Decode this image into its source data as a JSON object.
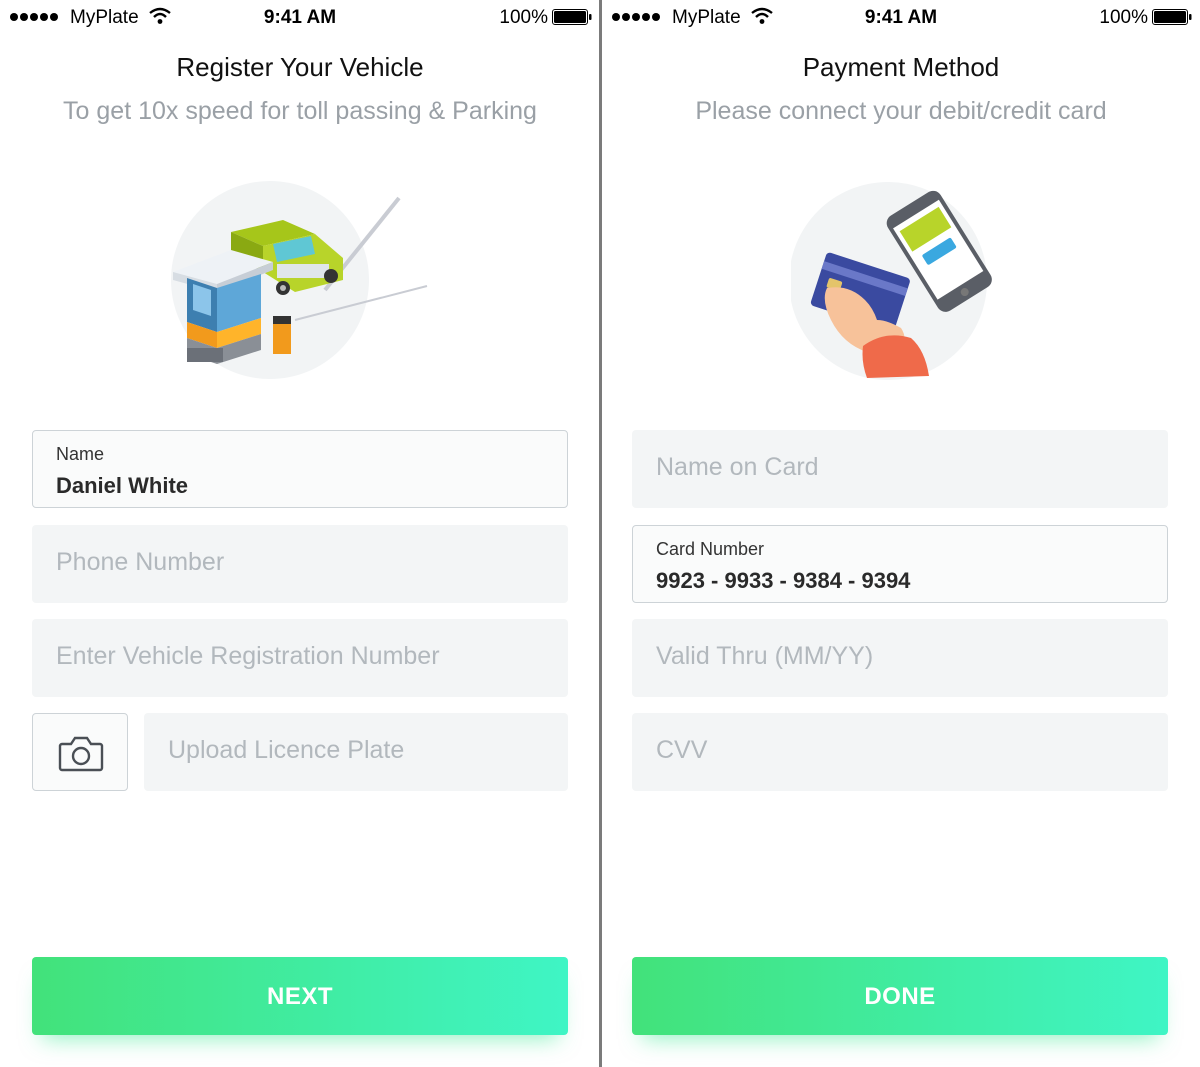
{
  "status_bar": {
    "carrier": "MyPlate",
    "time": "9:41 AM",
    "battery": "100%"
  },
  "register": {
    "title": "Register Your Vehicle",
    "subtitle": "To get 10x speed for toll passing & Parking",
    "name_field": {
      "label": "Name",
      "value": "Daniel White"
    },
    "phone_placeholder": "Phone Number",
    "vehicle_placeholder": "Enter Vehicle Registration Number",
    "upload_placeholder": "Upload Licence Plate",
    "next_label": "NEXT"
  },
  "payment": {
    "title": "Payment Method",
    "subtitle": "Please connect your debit/credit card",
    "name_on_card_placeholder": "Name on Card",
    "card_number_field": {
      "label": "Card Number",
      "value": "9923 - 9933 - 9384 - 9394"
    },
    "valid_thru_placeholder": "Valid Thru (MM/YY)",
    "cvv_placeholder": "CVV",
    "done_label": "DONE"
  },
  "accent_gradient": [
    "#42e27a",
    "#3ff5c5"
  ],
  "icons": {
    "signal": "signal-dots-icon",
    "wifi": "wifi-icon",
    "battery": "battery-icon",
    "camera": "camera-icon"
  }
}
